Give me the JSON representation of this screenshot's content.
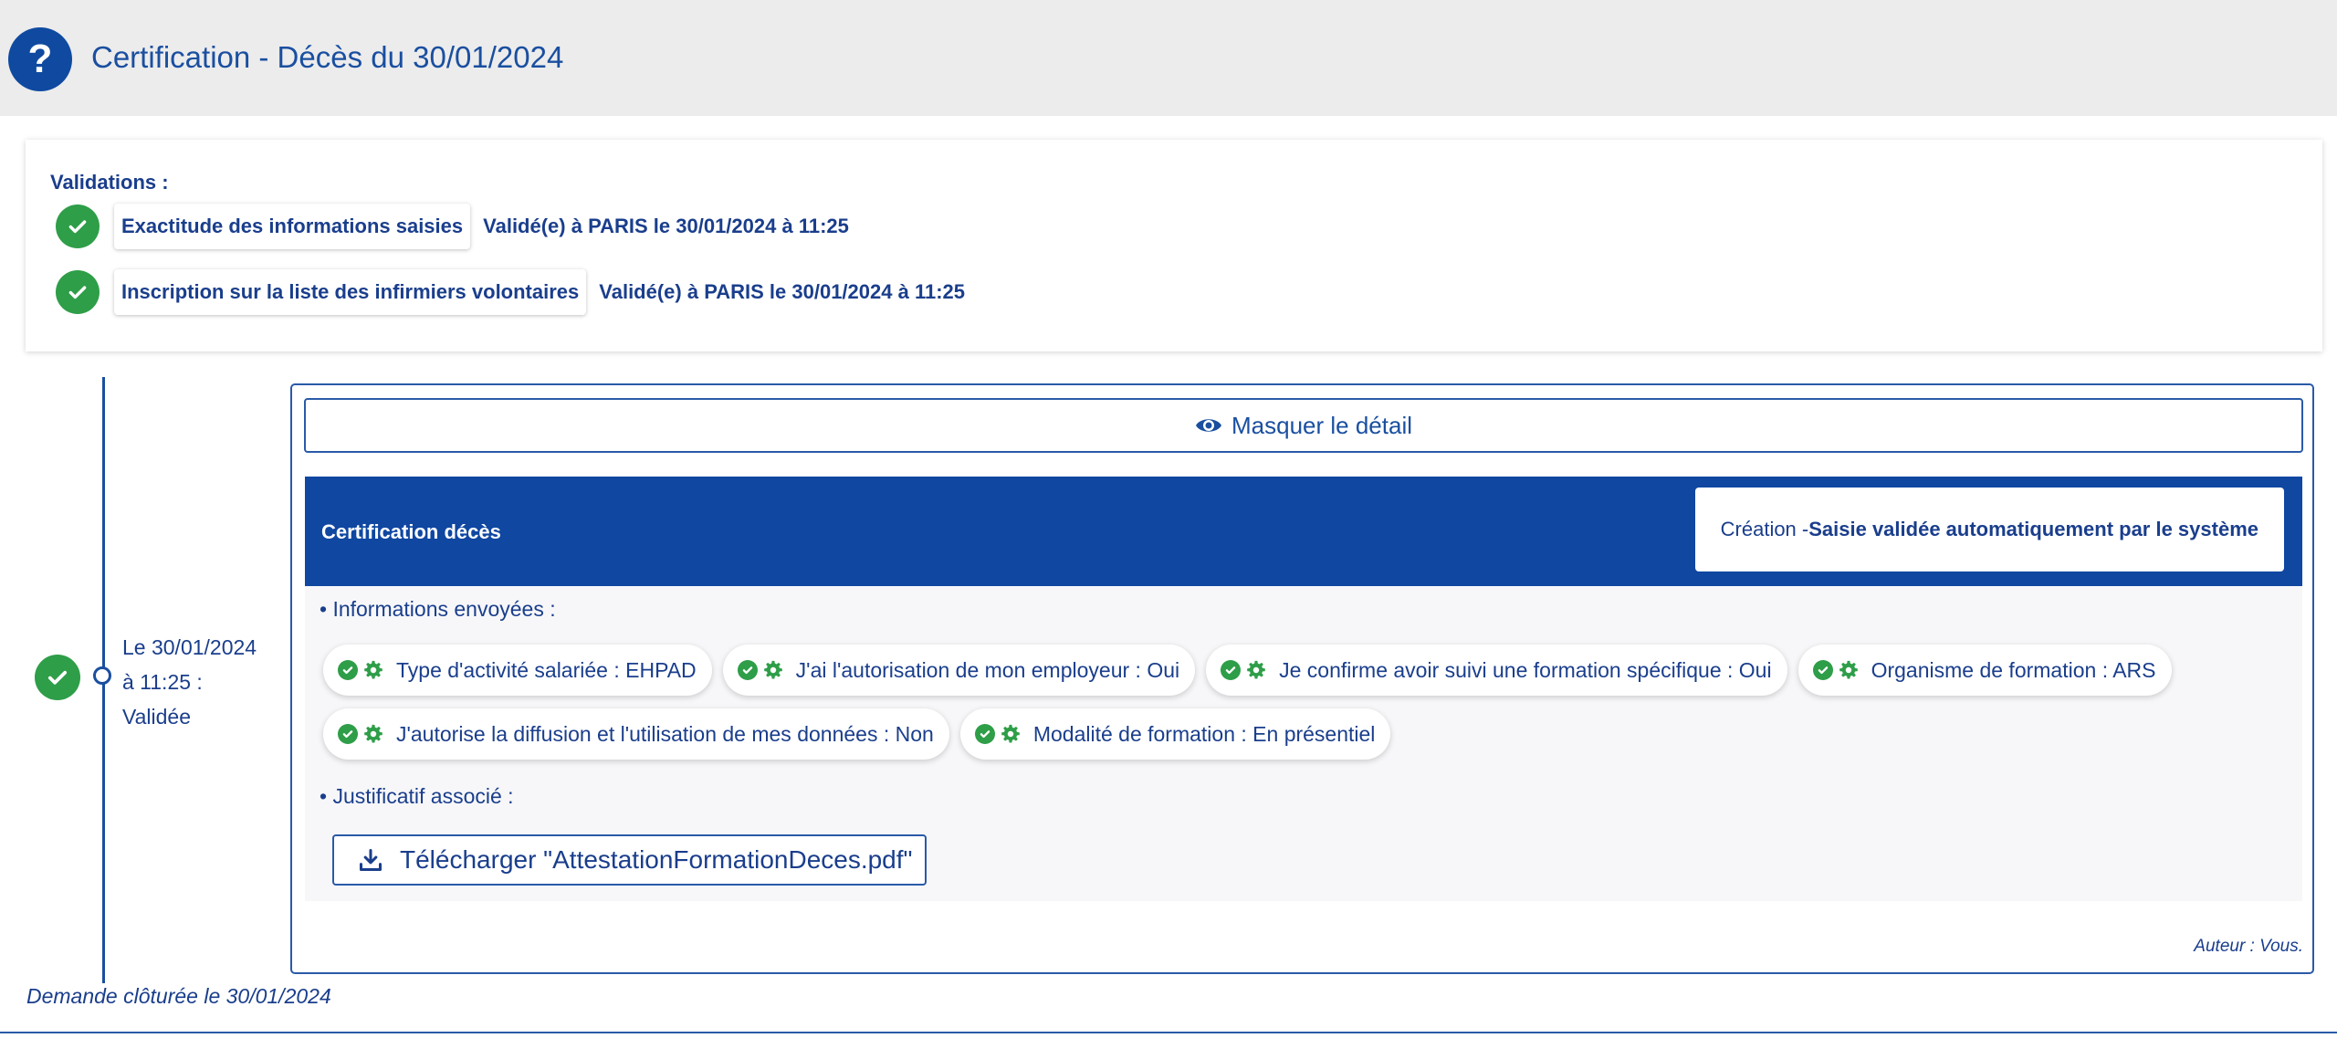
{
  "header": {
    "title": "Certification - Décès du 30/01/2024",
    "help_icon": "?"
  },
  "validations": {
    "title": "Validations :",
    "items": [
      {
        "label": "Exactitude des informations saisies",
        "status": "Validé(e) à PARIS le 30/01/2024 à 11:25"
      },
      {
        "label": "Inscription sur la liste des infirmiers volontaires",
        "status": "Validé(e) à PARIS le 30/01/2024 à 11:25"
      }
    ]
  },
  "timeline": {
    "date_line1": "Le 30/01/2024",
    "date_line2": "à 11:25 :",
    "date_line3": "Validée",
    "closed_text": "Demande clôturée le 30/01/2024"
  },
  "card": {
    "toggle_label": "Masquer le détail",
    "bar_title": "Certification décès",
    "status_prefix": "Création - ",
    "status_bold": "Saisie validée automatiquement par le système",
    "sent_label": "• Informations envoyées :",
    "chips_row1": [
      "Type d'activité salariée : EHPAD",
      "J'ai l'autorisation de mon employeur : Oui",
      "Je confirme avoir suivi une formation spécifique : Oui",
      "Organisme de formation : ARS"
    ],
    "chips_row2": [
      "J'autorise la diffusion et l'utilisation de mes données : Non",
      "Modalité de formation : En présentiel"
    ],
    "attachment_label": "• Justificatif associé :",
    "download_label": "Télécharger \"AttestationFormationDeces.pdf\"",
    "author": "Auteur : Vous."
  },
  "colors": {
    "primary": "#0f47a1",
    "success": "#2e9e48",
    "text": "#1a3e8c"
  },
  "icons": {
    "help": "question-icon",
    "check": "check-circle-icon",
    "eye": "eye-icon",
    "gear": "gear-icon",
    "download": "download-icon"
  }
}
